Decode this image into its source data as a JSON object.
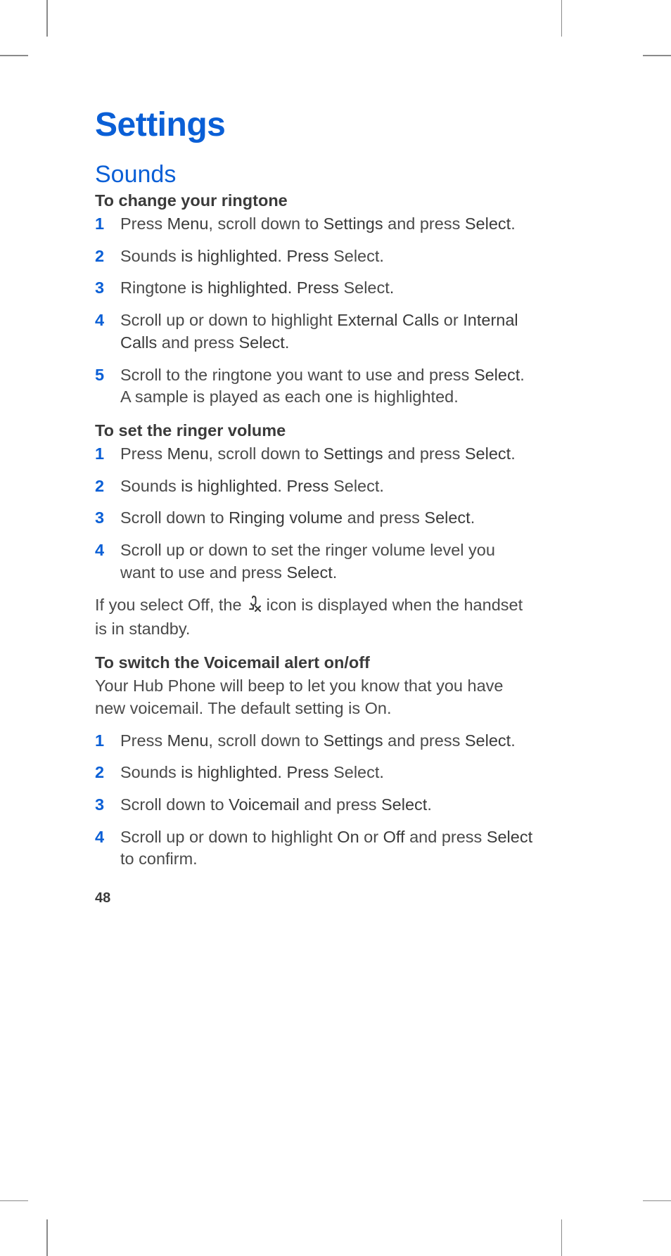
{
  "page_number": "48",
  "title": "Settings",
  "section": "Sounds",
  "groups": [
    {
      "heading": "To change your ringtone",
      "steps": [
        {
          "n": "1",
          "parts": [
            "Press ",
            "Menu",
            ", scroll down to ",
            "Settings",
            " and press ",
            "Select",
            "."
          ]
        },
        {
          "n": "2",
          "parts": [
            "Sounds",
            " is highlighted. Press ",
            "Select",
            "."
          ]
        },
        {
          "n": "3",
          "parts": [
            "Ringtone",
            " is highlighted. Press ",
            "Select",
            "."
          ]
        },
        {
          "n": "4",
          "parts": [
            "Scroll up or down to highlight ",
            "External Calls",
            " or ",
            "Internal Calls",
            " and press ",
            "Select",
            "."
          ]
        },
        {
          "n": "5",
          "parts": [
            "Scroll to the ringtone you want to use and press ",
            "Select",
            ". A sample is played as each one is highlighted."
          ]
        }
      ]
    },
    {
      "heading": "To set the ringer volume",
      "steps": [
        {
          "n": "1",
          "parts": [
            "Press ",
            "Menu",
            ", scroll down to ",
            "Settings",
            " and press ",
            "Select",
            "."
          ]
        },
        {
          "n": "2",
          "parts": [
            "Sounds",
            " is highlighted. Press ",
            "Select",
            "."
          ]
        },
        {
          "n": "3",
          "parts": [
            "Scroll down to ",
            "Ringing volume",
            " and press ",
            "Select",
            "."
          ]
        },
        {
          "n": "4",
          "parts": [
            "Scroll up or down to set the ringer volume level you want to use and press ",
            "Select",
            "."
          ]
        }
      ],
      "after_text_pre": "If you select Off, the ",
      "after_icon": "ringer-off-icon",
      "after_text_post": " icon is displayed when the handset is in standby."
    },
    {
      "heading": "To switch the Voicemail alert on/off",
      "intro": "Your Hub Phone will beep to let you know that you have new voicemail. The default setting is On.",
      "steps": [
        {
          "n": "1",
          "parts": [
            "Press ",
            "Menu",
            ", scroll down to ",
            "Settings",
            " and press ",
            "Select",
            "."
          ]
        },
        {
          "n": "2",
          "parts": [
            "Sounds",
            " is highlighted. Press ",
            "Select",
            "."
          ]
        },
        {
          "n": "3",
          "parts": [
            "Scroll down to ",
            "Voicemail",
            " and press ",
            "Select",
            "."
          ]
        },
        {
          "n": "4",
          "parts": [
            "Scroll up or down to highlight ",
            "On",
            " or ",
            "Off",
            " and press ",
            "Select",
            " to confirm."
          ]
        }
      ]
    }
  ]
}
